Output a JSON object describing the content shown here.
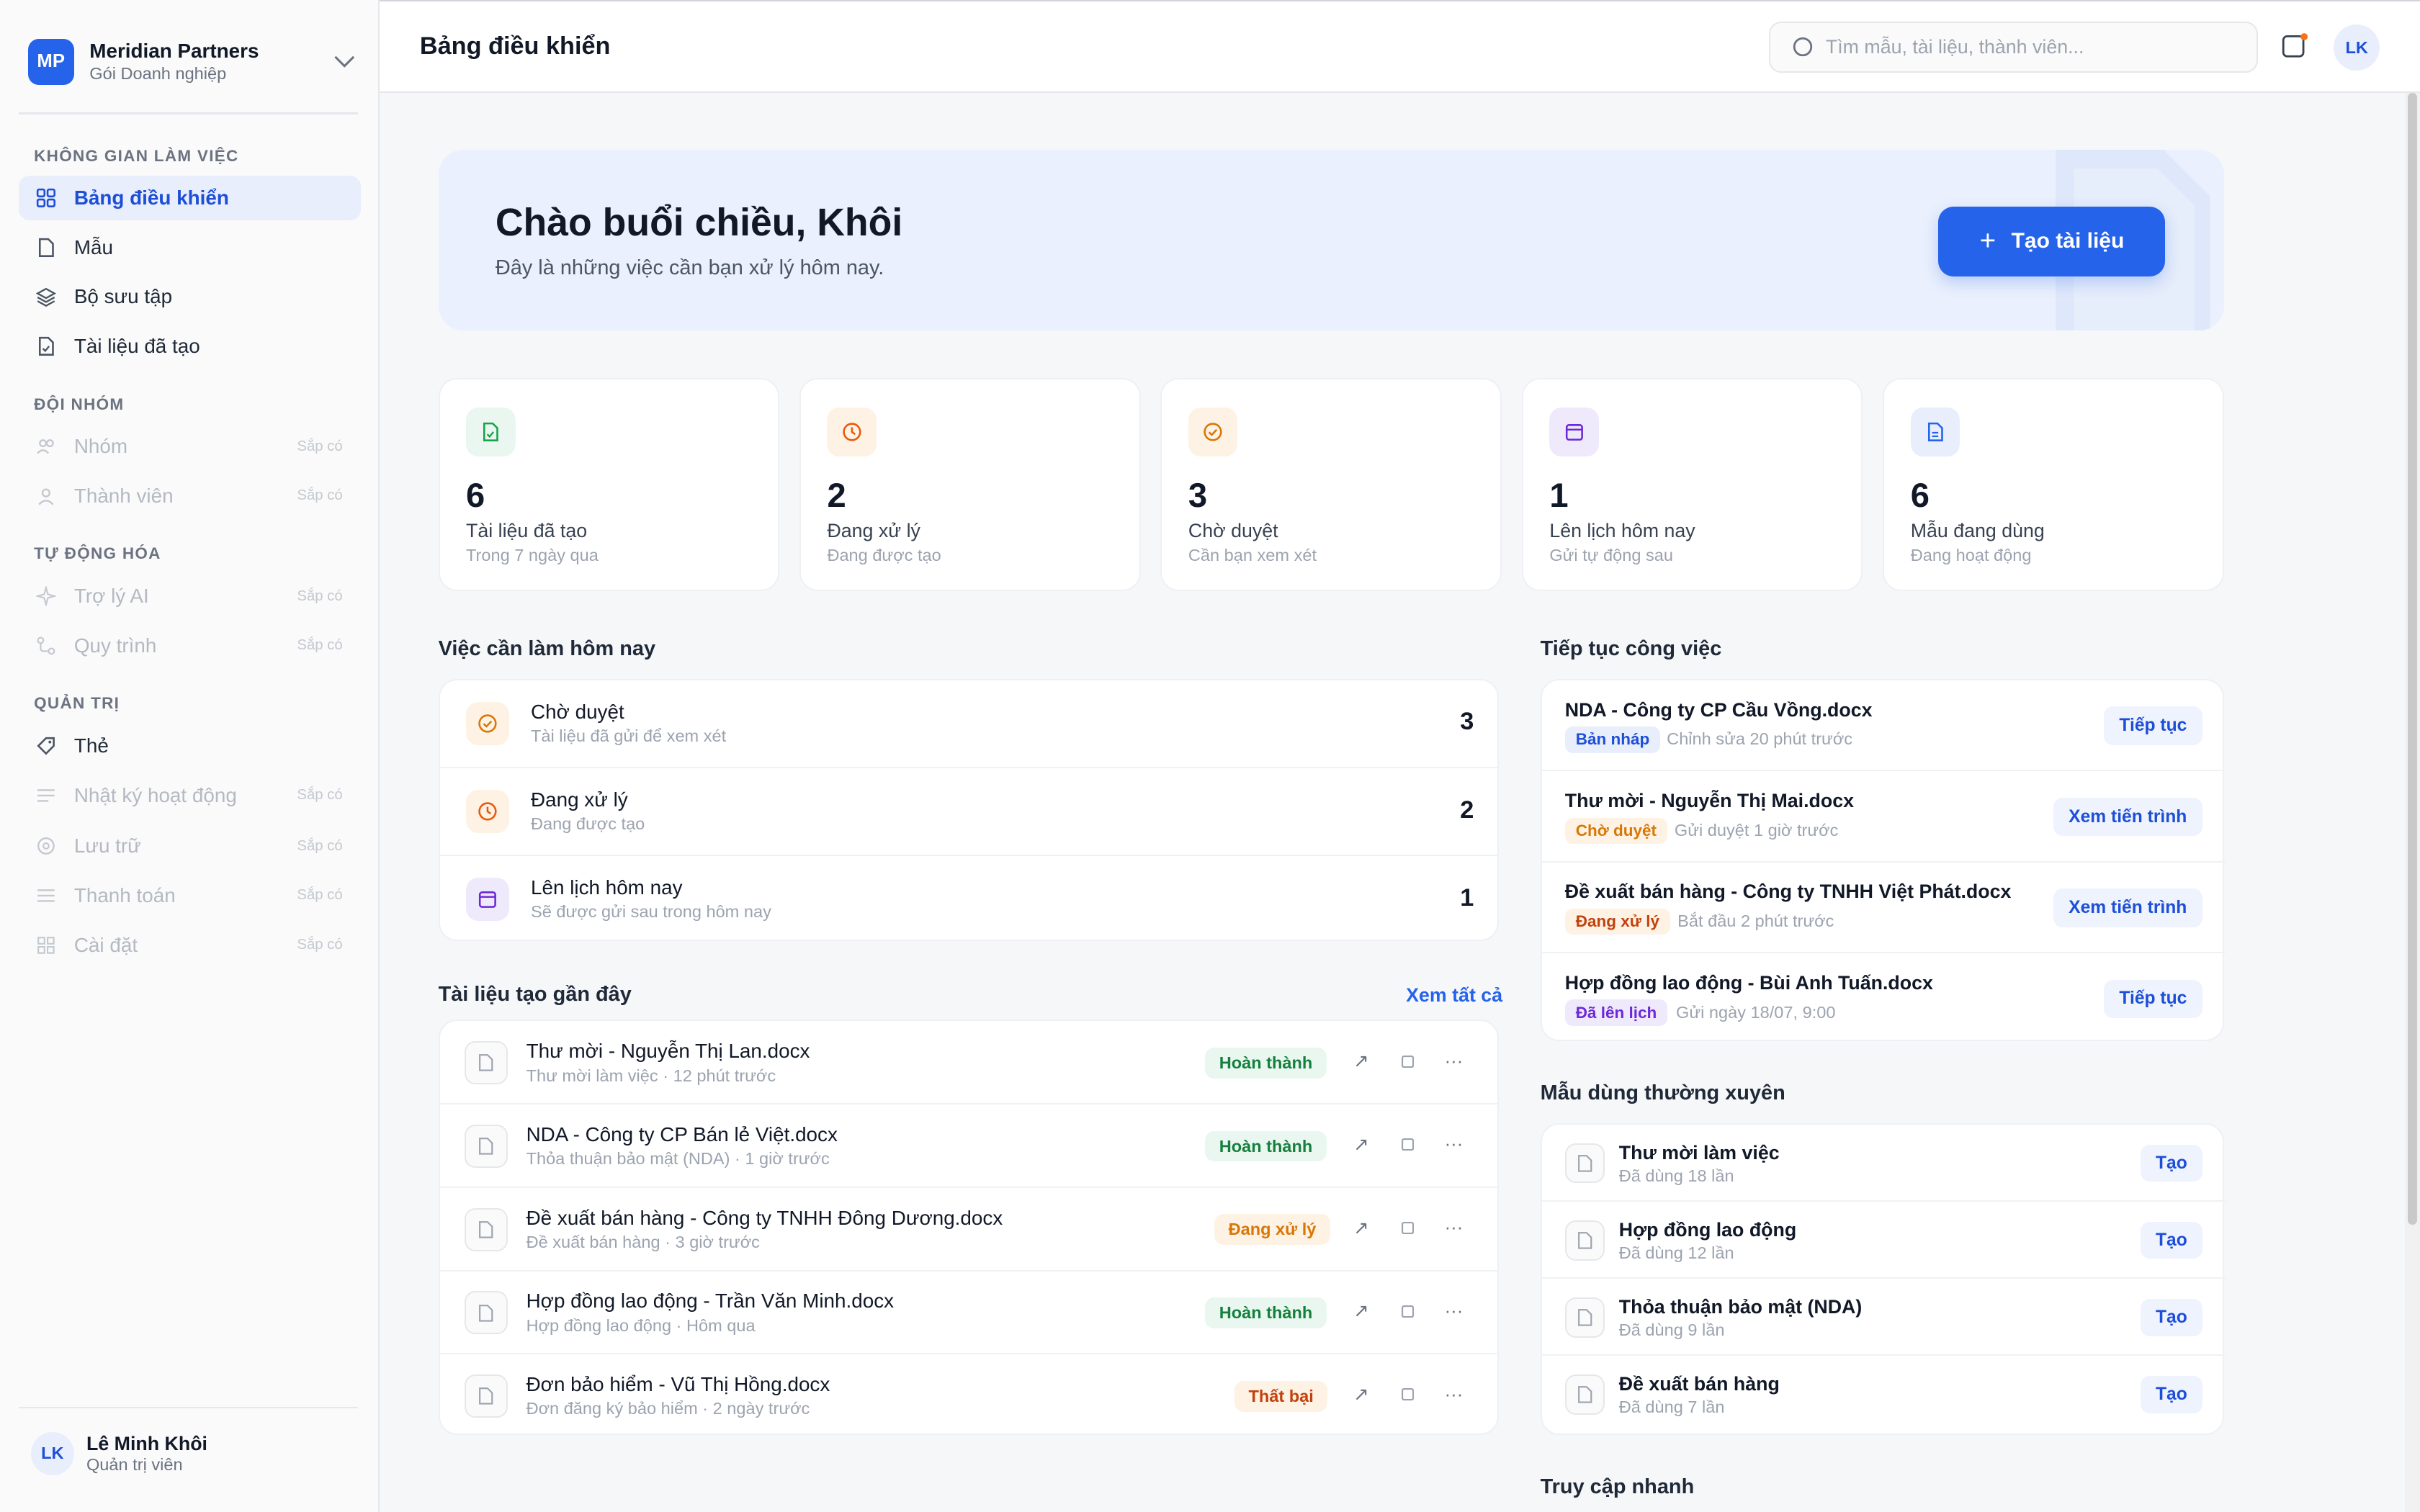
{
  "workspace": {
    "logo": "MP",
    "name": "Meridian Partners",
    "plan": "Gói Doanh nghiệp"
  },
  "sidebar": {
    "sections": [
      {
        "label": "KHÔNG GIAN LÀM VIỆC"
      },
      {
        "label": "ĐỘI NHÓM"
      },
      {
        "label": "TỰ ĐỘNG HÓA"
      },
      {
        "label": "QUẢN TRỊ"
      }
    ],
    "items": [
      {
        "label": "Bảng điều khiển",
        "icon": "grid-icon",
        "active": true
      },
      {
        "label": "Mẫu",
        "icon": "file-icon"
      },
      {
        "label": "Bộ sưu tập",
        "icon": "layers-icon"
      },
      {
        "label": "Tài liệu đã tạo",
        "icon": "document-check-icon"
      },
      {
        "label": "Nhóm",
        "icon": "users-icon",
        "soon": "Sắp có"
      },
      {
        "label": "Thành viên",
        "icon": "user-icon",
        "soon": "Sắp có"
      },
      {
        "label": "Trợ lý AI",
        "icon": "sparkle-icon",
        "soon": "Sắp có"
      },
      {
        "label": "Quy trình",
        "icon": "workflow-icon",
        "soon": "Sắp có"
      },
      {
        "label": "Thẻ",
        "icon": "tag-icon"
      },
      {
        "label": "Nhật ký hoạt động",
        "icon": "list-icon",
        "soon": "Sắp có"
      },
      {
        "label": "Lưu trữ",
        "icon": "archive-icon",
        "soon": "Sắp có"
      },
      {
        "label": "Thanh toán",
        "icon": "card-icon",
        "soon": "Sắp có"
      },
      {
        "label": "Cài đặt",
        "icon": "gear-icon",
        "soon": "Sắp có"
      }
    ]
  },
  "user": {
    "initials": "LK",
    "name": "Lê Minh Khôi",
    "role": "Quản trị viên"
  },
  "header": {
    "title": "Bảng điều khiển",
    "search_placeholder": "Tìm mẫu, tài liệu, thành viên...",
    "avatar": "LK"
  },
  "hero": {
    "title": "Chào buổi chiều, Khôi",
    "subtitle": "Đây là những việc cần bạn xử lý hôm nay.",
    "button": "Tạo tài liệu"
  },
  "stats": [
    {
      "value": "6",
      "label": "Tài liệu đã tạo",
      "sub": "Trong 7 ngày qua",
      "icon": "document-check-icon",
      "color": "#16a34a",
      "bg": "#eaf7f0"
    },
    {
      "value": "2",
      "label": "Đang xử lý",
      "sub": "Đang được tạo",
      "icon": "clock-icon",
      "color": "#ea580c",
      "bg": "#fdf2e4"
    },
    {
      "value": "3",
      "label": "Chờ duyệt",
      "sub": "Cần bạn xem xét",
      "icon": "check-circle-icon",
      "color": "#d97706",
      "bg": "#fdf2e4"
    },
    {
      "value": "1",
      "label": "Lên lịch hôm nay",
      "sub": "Gửi tự động sau",
      "icon": "calendar-icon",
      "color": "#6d28d9",
      "bg": "#efeafb"
    },
    {
      "value": "6",
      "label": "Mẫu đang dùng",
      "sub": "Đang hoạt động",
      "icon": "file-icon",
      "color": "#2563eb",
      "bg": "#e8eefb"
    }
  ],
  "todo": {
    "title": "Việc cần làm hôm nay",
    "items": [
      {
        "title": "Chờ duyệt",
        "sub": "Tài liệu đã gửi để xem xét",
        "count": "3",
        "icon": "check-circle-icon",
        "color": "#d97706",
        "bg": "#fdf2e4"
      },
      {
        "title": "Đang xử lý",
        "sub": "Đang được tạo",
        "count": "2",
        "icon": "clock-icon",
        "color": "#ea580c",
        "bg": "#fdf2e4"
      },
      {
        "title": "Lên lịch hôm nay",
        "sub": "Sẽ được gửi sau trong hôm nay",
        "count": "1",
        "icon": "calendar-icon",
        "color": "#6d28d9",
        "bg": "#efeafb"
      }
    ]
  },
  "recent": {
    "title": "Tài liệu tạo gần đây",
    "view_all": "Xem tất cả",
    "items": [
      {
        "title": "Thư mời - Nguyễn Thị Lan.docx",
        "sub": "Thư mời làm việc · 12 phút trước",
        "status": "Hoàn thành",
        "kind": "green"
      },
      {
        "title": "NDA - Công ty CP Bán lẻ Việt.docx",
        "sub": "Thỏa thuận bảo mật (NDA) · 1 giờ trước",
        "status": "Hoàn thành",
        "kind": "green"
      },
      {
        "title": "Đề xuất bán hàng - Công ty TNHH Đông Dương.docx",
        "sub": "Đề xuất bán hàng · 3 giờ trước",
        "status": "Đang xử lý",
        "kind": "orange"
      },
      {
        "title": "Hợp đồng lao động - Trần Văn Minh.docx",
        "sub": "Hợp đồng lao động · Hôm qua",
        "status": "Hoàn thành",
        "kind": "green"
      },
      {
        "title": "Đơn bảo hiểm - Vũ Thị Hồng.docx",
        "sub": "Đơn đăng ký bảo hiểm · 2 ngày trước",
        "status": "Thất bại",
        "kind": "amber"
      }
    ]
  },
  "continue": {
    "title": "Tiếp tục công việc",
    "items": [
      {
        "title": "NDA - Công ty CP Cầu Vồng.docx",
        "status": "Bản nháp",
        "kind": "blue",
        "time": "Chỉnh sửa 20 phút trước",
        "action": "Tiếp tục"
      },
      {
        "title": "Thư mời - Nguyễn Thị Mai.docx",
        "status": "Chờ duyệt",
        "kind": "orange",
        "time": "Gửi duyệt 1 giờ trước",
        "action": "Xem tiến trình"
      },
      {
        "title": "Đề xuất bán hàng - Công ty TNHH Việt Phát.docx",
        "status": "Đang xử lý",
        "kind": "amber",
        "time": "Bắt đầu 2 phút trước",
        "action": "Xem tiến trình"
      },
      {
        "title": "Hợp đồng lao động - Bùi Anh Tuấn.docx",
        "status": "Đã lên lịch",
        "kind": "purple",
        "time": "Gửi ngày 18/07, 9:00",
        "action": "Tiếp tục"
      }
    ]
  },
  "templates": {
    "title": "Mẫu dùng thường xuyên",
    "items": [
      {
        "title": "Thư mời làm việc",
        "sub": "Đã dùng 18 lần",
        "action": "Tạo"
      },
      {
        "title": "Hợp đồng lao động",
        "sub": "Đã dùng 12 lần",
        "action": "Tạo"
      },
      {
        "title": "Thỏa thuận bảo mật (NDA)",
        "sub": "Đã dùng 9 lần",
        "action": "Tạo"
      },
      {
        "title": "Đề xuất bán hàng",
        "sub": "Đã dùng 7 lần",
        "action": "Tạo"
      }
    ]
  },
  "quick_access": {
    "title": "Truy cập nhanh"
  }
}
